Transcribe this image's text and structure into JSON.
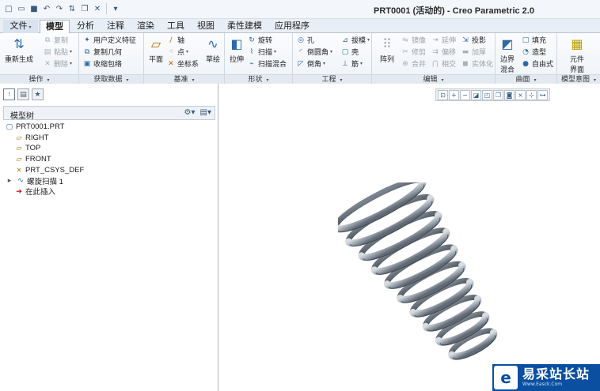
{
  "window": {
    "title": "PRT0001 (活动的) - Creo Parametric 2.0"
  },
  "quick_access": [
    "new-icon",
    "open-icon",
    "save-icon",
    "undo-icon",
    "redo-icon",
    "regenerate-icon",
    "windows-icon",
    "close-window-icon",
    "customize-icon"
  ],
  "tabs": [
    {
      "label": "文件",
      "has_dropdown": true
    },
    {
      "label": "模型",
      "active": true
    },
    {
      "label": "分析"
    },
    {
      "label": "注释"
    },
    {
      "label": "渲染"
    },
    {
      "label": "工具"
    },
    {
      "label": "视图"
    },
    {
      "label": "柔性建模"
    },
    {
      "label": "应用程序"
    }
  ],
  "ribbon": {
    "operations": {
      "label": "操作",
      "regenerate": "重新生成",
      "copy": "复制",
      "paste": "粘贴",
      "delete": "删除"
    },
    "get_data": {
      "label": "获取数据",
      "udf": "用户定义特征",
      "copy_geom": "复制几何",
      "shrinkwrap": "收缩包络"
    },
    "datum": {
      "label": "基准",
      "plane": "平面",
      "axis": "轴",
      "point": "点",
      "csys": "坐标系",
      "sketch": "草绘"
    },
    "shapes": {
      "label": "形状",
      "extrude": "拉伸",
      "revolve": "旋转",
      "sweep": "扫描",
      "swept_blend": "扫描混合"
    },
    "engineering": {
      "label": "工程",
      "hole": "孔",
      "round": "倒圆角",
      "chamfer": "倒角",
      "draft": "拔模",
      "shell": "壳",
      "rib": "筋"
    },
    "editing": {
      "label": "编辑",
      "pattern": "阵列",
      "mirror": "镜像",
      "trim": "修剪",
      "merge": "合并",
      "extend": "延伸",
      "offset": "偏移",
      "intersect": "相交",
      "project": "投影",
      "thicken": "加厚",
      "solidify": "实体化"
    },
    "surfaces": {
      "label": "曲面",
      "boundary_blend_1": "边界",
      "boundary_blend_2": "混合",
      "fill": "填充",
      "style": "造型",
      "freestyle": "自由式"
    },
    "model_intent": {
      "label": "模型意图",
      "component_interface_1": "元件",
      "component_interface_2": "界面"
    }
  },
  "model_tree": {
    "title": "模型树",
    "items": [
      {
        "label": "PRT0001.PRT",
        "icon": "part-icon"
      },
      {
        "label": "RIGHT",
        "icon": "datum-plane-icon"
      },
      {
        "label": "TOP",
        "icon": "datum-plane-icon"
      },
      {
        "label": "FRONT",
        "icon": "datum-plane-icon"
      },
      {
        "label": "PRT_CSYS_DEF",
        "icon": "csys-icon"
      },
      {
        "label": "螺旋扫描 1",
        "icon": "helical-sweep-icon",
        "expandable": true
      },
      {
        "label": "在此插入",
        "icon": "insert-here-icon"
      }
    ]
  },
  "view_toolbar": [
    "refit-icon",
    "zoom-in-icon",
    "zoom-out-icon",
    "repaint-icon",
    "reorient-icon",
    "saved-views-icon",
    "display-style-icon",
    "datum-display-icon",
    "spin-center-icon",
    "annotation-display-icon"
  ],
  "watermark": {
    "name": "易采站长站",
    "url": "Www.Easck.Com"
  },
  "colors": {
    "accent": "#2d6aa8",
    "logo": "#0a4fa0",
    "spring": "#9aa3ad"
  }
}
